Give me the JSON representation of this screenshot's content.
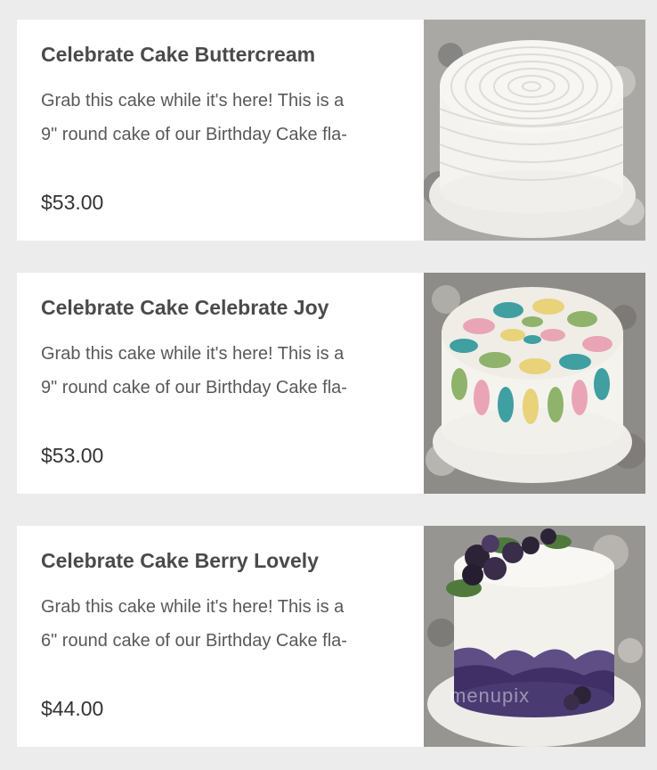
{
  "products": [
    {
      "title": "Celebrate Cake Buttercream",
      "description_line1": "Grab this cake while it's here! This is a",
      "description_line2": "9\" round cake of our Birthday Cake fla-",
      "price": "$53.00",
      "image_alt": "White buttercream cake"
    },
    {
      "title": "Celebrate Cake Celebrate Joy",
      "description_line1": "Grab this cake while it's here! This is a",
      "description_line2": "9\" round cake of our Birthday Cake fla-",
      "price": "$53.00",
      "image_alt": "Colorful petal cake"
    },
    {
      "title": "Celebrate Cake Berry Lovely",
      "description_line1": "Grab this cake while it's here! This is a",
      "description_line2": "6\" round cake of our Birthday Cake fla-",
      "price": "$44.00",
      "image_alt": "Berry topped cake",
      "watermark": "menupix"
    }
  ],
  "colors": {
    "page_background": "#ececec",
    "card_background": "#ffffff",
    "title_text": "#4a4a4a",
    "body_text": "#595959",
    "price_text": "#333333"
  }
}
